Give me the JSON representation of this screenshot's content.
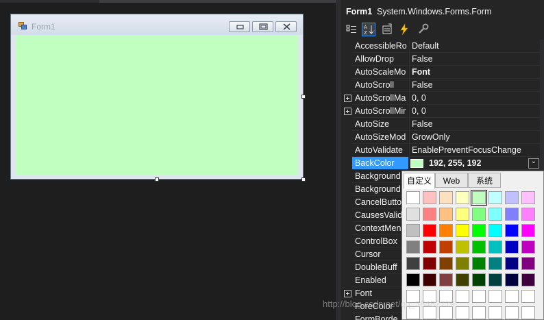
{
  "form": {
    "title": "Form1",
    "client_color": "#c0ffc0",
    "buttons": {
      "minimize": "▭",
      "maximize": "▣",
      "close": "✕"
    }
  },
  "properties": {
    "object_name": "Form1",
    "object_type": "System.Windows.Forms.Form",
    "toolbar": [
      "categorized-icon",
      "alphabetical-icon",
      "properties-icon",
      "events-icon",
      "property-pages-icon"
    ],
    "rows": [
      {
        "name": "AccessibleRo",
        "value": "Default",
        "expandable": false
      },
      {
        "name": "AllowDrop",
        "value": "False",
        "expandable": false
      },
      {
        "name": "AutoScaleMo",
        "value": "Font",
        "expandable": false,
        "bold": true
      },
      {
        "name": "AutoScroll",
        "value": "False",
        "expandable": false
      },
      {
        "name": "AutoScrollMa",
        "value": "0, 0",
        "expandable": true
      },
      {
        "name": "AutoScrollMir",
        "value": "0, 0",
        "expandable": true
      },
      {
        "name": "AutoSize",
        "value": "False",
        "expandable": false
      },
      {
        "name": "AutoSizeMod",
        "value": "GrowOnly",
        "expandable": false
      },
      {
        "name": "AutoValidate",
        "value": "EnablePreventFocusChange",
        "expandable": false
      },
      {
        "name": "BackColor",
        "value": "192, 255, 192",
        "expandable": false,
        "selected": true
      },
      {
        "name": "Background",
        "value": "",
        "expandable": false
      },
      {
        "name": "Background",
        "value": "",
        "expandable": false
      },
      {
        "name": "CancelButto",
        "value": "",
        "expandable": false
      },
      {
        "name": "CausesValid",
        "value": "",
        "expandable": false
      },
      {
        "name": "ContextMen",
        "value": "",
        "expandable": false
      },
      {
        "name": "ControlBox",
        "value": "",
        "expandable": false
      },
      {
        "name": "Cursor",
        "value": "",
        "expandable": false
      },
      {
        "name": "DoubleBuff",
        "value": "",
        "expandable": false
      },
      {
        "name": "Enabled",
        "value": "",
        "expandable": false
      },
      {
        "name": "Font",
        "value": "",
        "expandable": true
      },
      {
        "name": "ForeColor",
        "value": "",
        "expandable": false
      },
      {
        "name": "FormBorde",
        "value": "",
        "expandable": false
      }
    ],
    "backcolor_swatch": "#c0ffc0",
    "dropdown_glyph": "⌄"
  },
  "color_picker": {
    "tabs": [
      "自定义",
      "Web",
      "系统"
    ],
    "active_tab": 0,
    "selected_cell": [
      0,
      4
    ],
    "colors": [
      [
        "#ffffff",
        "#ffc0c0",
        "#ffe0c0",
        "#ffffc0",
        "#c0ffc0",
        "#c0ffff",
        "#c0c0ff",
        "#ffc0ff"
      ],
      [
        "#e0e0e0",
        "#ff8080",
        "#ffc080",
        "#ffff80",
        "#80ff80",
        "#80ffff",
        "#8080ff",
        "#ff80ff"
      ],
      [
        "#c0c0c0",
        "#ff0000",
        "#ff8000",
        "#ffff00",
        "#00ff00",
        "#00ffff",
        "#0000ff",
        "#ff00ff"
      ],
      [
        "#808080",
        "#c00000",
        "#c04000",
        "#c0c000",
        "#00c000",
        "#00c0c0",
        "#0000c0",
        "#c000c0"
      ],
      [
        "#404040",
        "#800000",
        "#804000",
        "#808000",
        "#008000",
        "#008080",
        "#000080",
        "#800080"
      ],
      [
        "#000000",
        "#400000",
        "#804040",
        "#404000",
        "#004000",
        "#004040",
        "#000040",
        "#400040"
      ],
      [
        "#ffffff",
        "#ffffff",
        "#ffffff",
        "#ffffff",
        "#ffffff",
        "#ffffff",
        "#ffffff",
        "#ffffff"
      ],
      [
        "#ffffff",
        "#ffffff",
        "#ffffff",
        "#ffffff",
        "#ffffff",
        "#ffffff",
        "#ffffff",
        "#ffffff"
      ]
    ]
  },
  "watermark": "http://blog.csdn.net/qq_38482779"
}
